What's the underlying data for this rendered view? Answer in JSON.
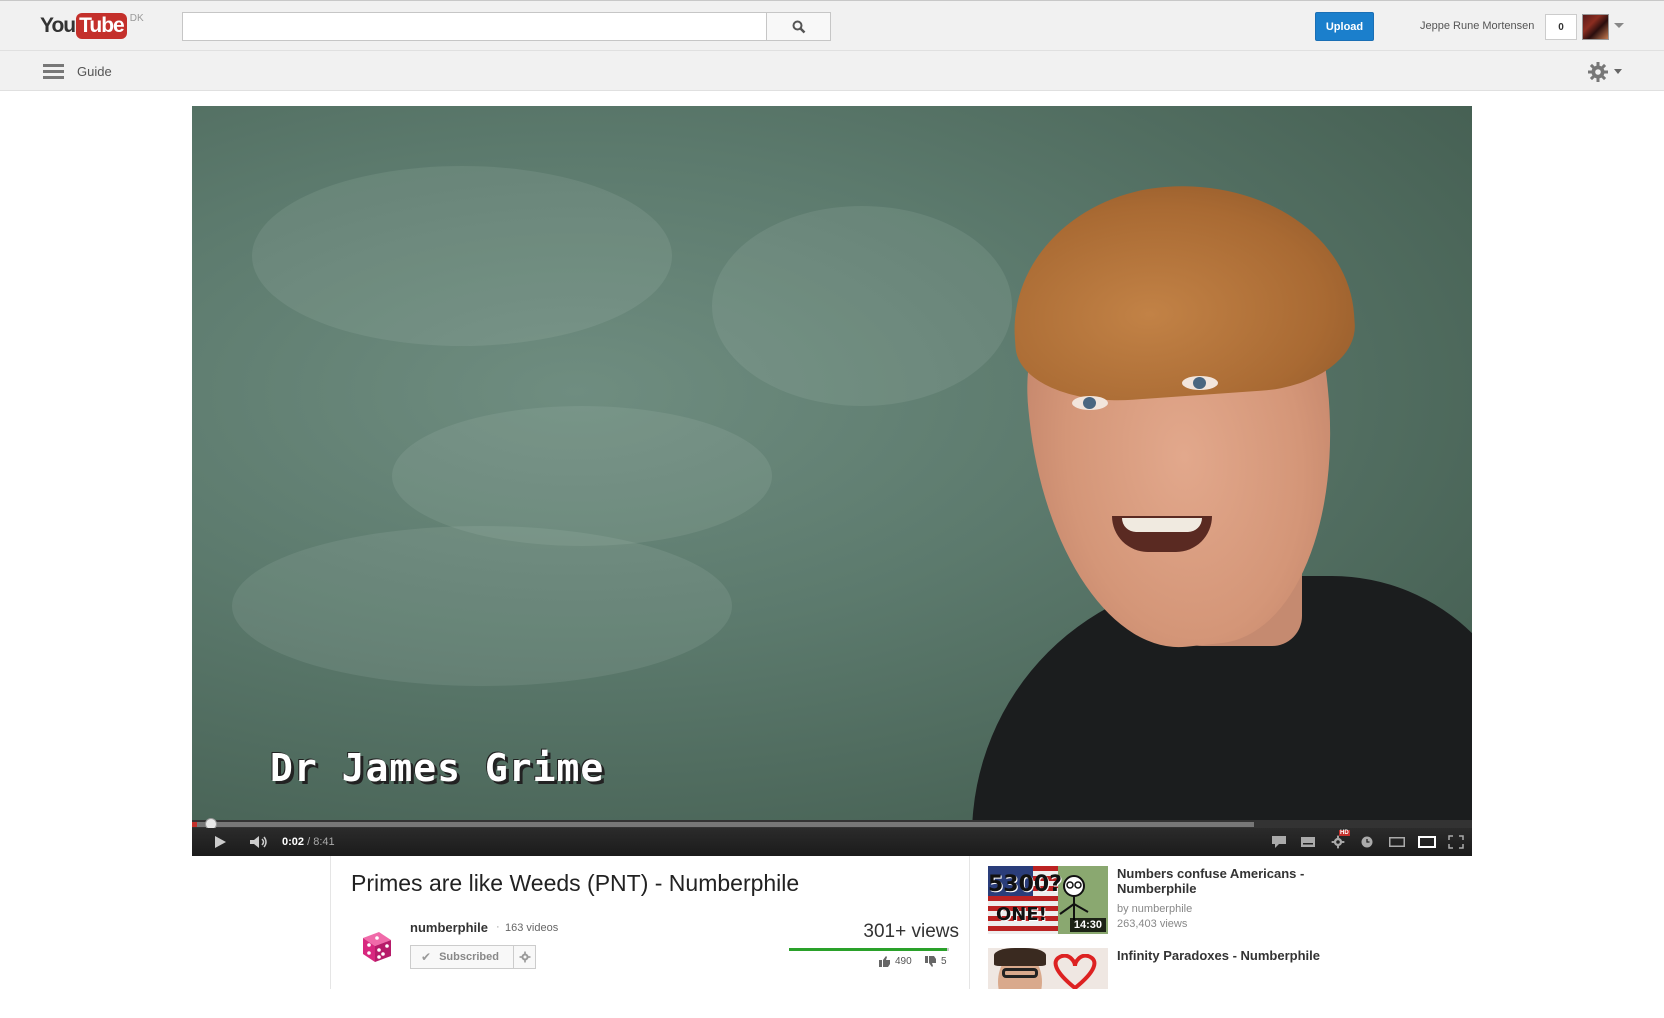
{
  "header": {
    "logo_you": "You",
    "logo_tube": "Tube",
    "country_code": "DK",
    "search_placeholder": "",
    "upload_label": "Upload",
    "user_name": "Jeppe Rune Mortensen",
    "notification_count": "0"
  },
  "guide": {
    "label": "Guide"
  },
  "player": {
    "caption": "Dr James Grime",
    "current_time": "0:02",
    "separator": "/",
    "duration": "8:41",
    "progress_played": 0.004,
    "progress_loaded": 0.83,
    "hd_badge": "HD"
  },
  "video": {
    "title": "Primes are like Weeds (PNT) - Numberphile",
    "channel_name": "numberphile",
    "channel_sep": "·",
    "video_count": "163 videos",
    "subscribe_label": "Subscribed",
    "views": "301+ views",
    "like_ratio": 0.99,
    "likes": "490",
    "dislikes": "5"
  },
  "related": [
    {
      "title": "Numbers confuse Americans - Numberphile",
      "by": "by numberphile",
      "views": "263,403 views",
      "duration": "14:30",
      "thumb_text_1": "5300?",
      "thumb_text_2": "ONE!"
    },
    {
      "title": "Infinity Paradoxes - Numberphile",
      "by": "",
      "views": "",
      "duration": ""
    }
  ],
  "colors": {
    "brand_red": "#c4302b",
    "upload_blue": "#1b7fcc",
    "like_green": "#2aa12a"
  }
}
